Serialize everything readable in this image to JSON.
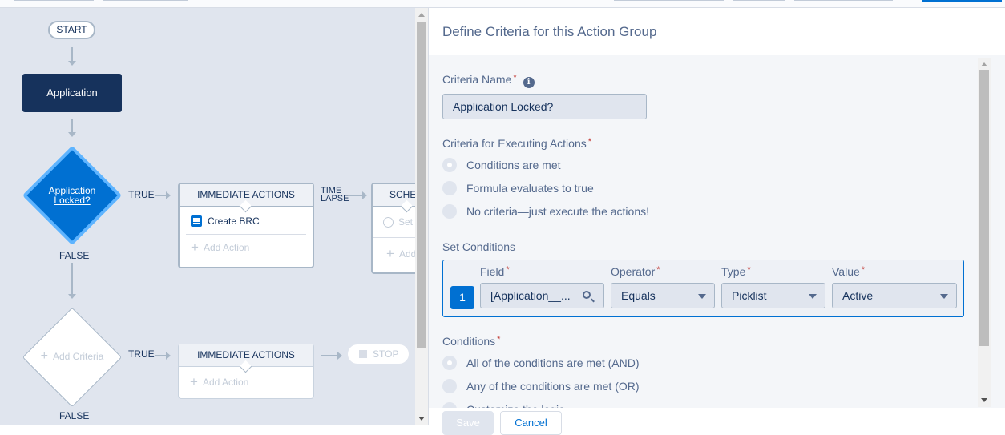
{
  "flow": {
    "start_label": "START",
    "object_label": "Application",
    "criteria_node_1": {
      "label_line1": "Application",
      "label_line2": "Locked?",
      "true_label": "TRUE",
      "false_label": "FALSE"
    },
    "immediate_actions_1": {
      "header": "IMMEDIATE ACTIONS",
      "actions": [
        "Create BRC"
      ],
      "add_action_label": "Add Action"
    },
    "time_lapse_label_line1": "TIME",
    "time_lapse_label_line2": "LAPSE",
    "scheduled_actions": {
      "header": "SCHE",
      "set_label": "Set",
      "add_label": "Add"
    },
    "criteria_node_2": {
      "add_criteria_label": "Add Criteria",
      "true_label": "TRUE",
      "false_label": "FALSE"
    },
    "immediate_actions_2": {
      "header": "IMMEDIATE ACTIONS",
      "add_action_label": "Add Action"
    },
    "stop_label": "STOP"
  },
  "panel": {
    "title": "Define Criteria for this Action Group",
    "criteria_name": {
      "label": "Criteria Name",
      "required_mark": "*",
      "info_icon": "i",
      "value": "Application Locked?"
    },
    "executing_criteria": {
      "label": "Criteria for Executing Actions",
      "required_mark": "*",
      "options": [
        {
          "label": "Conditions are met",
          "checked": true
        },
        {
          "label": "Formula evaluates to true",
          "checked": false
        },
        {
          "label": "No criteria—just execute the actions!",
          "checked": false
        }
      ]
    },
    "set_conditions": {
      "label": "Set Conditions",
      "rows": [
        {
          "number": "1",
          "field_label": "Field",
          "field_value": "[Application__...",
          "operator_label": "Operator",
          "operator_value": "Equals",
          "type_label": "Type",
          "type_value": "Picklist",
          "value_label": "Value",
          "value_value": "Active"
        }
      ],
      "required_mark": "*"
    },
    "conditions": {
      "label": "Conditions",
      "required_mark": "*",
      "options": [
        {
          "label": "All of the conditions are met (AND)",
          "checked": true
        },
        {
          "label": "Any of the conditions are met (OR)",
          "checked": false
        },
        {
          "label": "Customize the logic",
          "checked": false
        }
      ]
    },
    "footer": {
      "save_label": "Save",
      "cancel_label": "Cancel"
    }
  }
}
